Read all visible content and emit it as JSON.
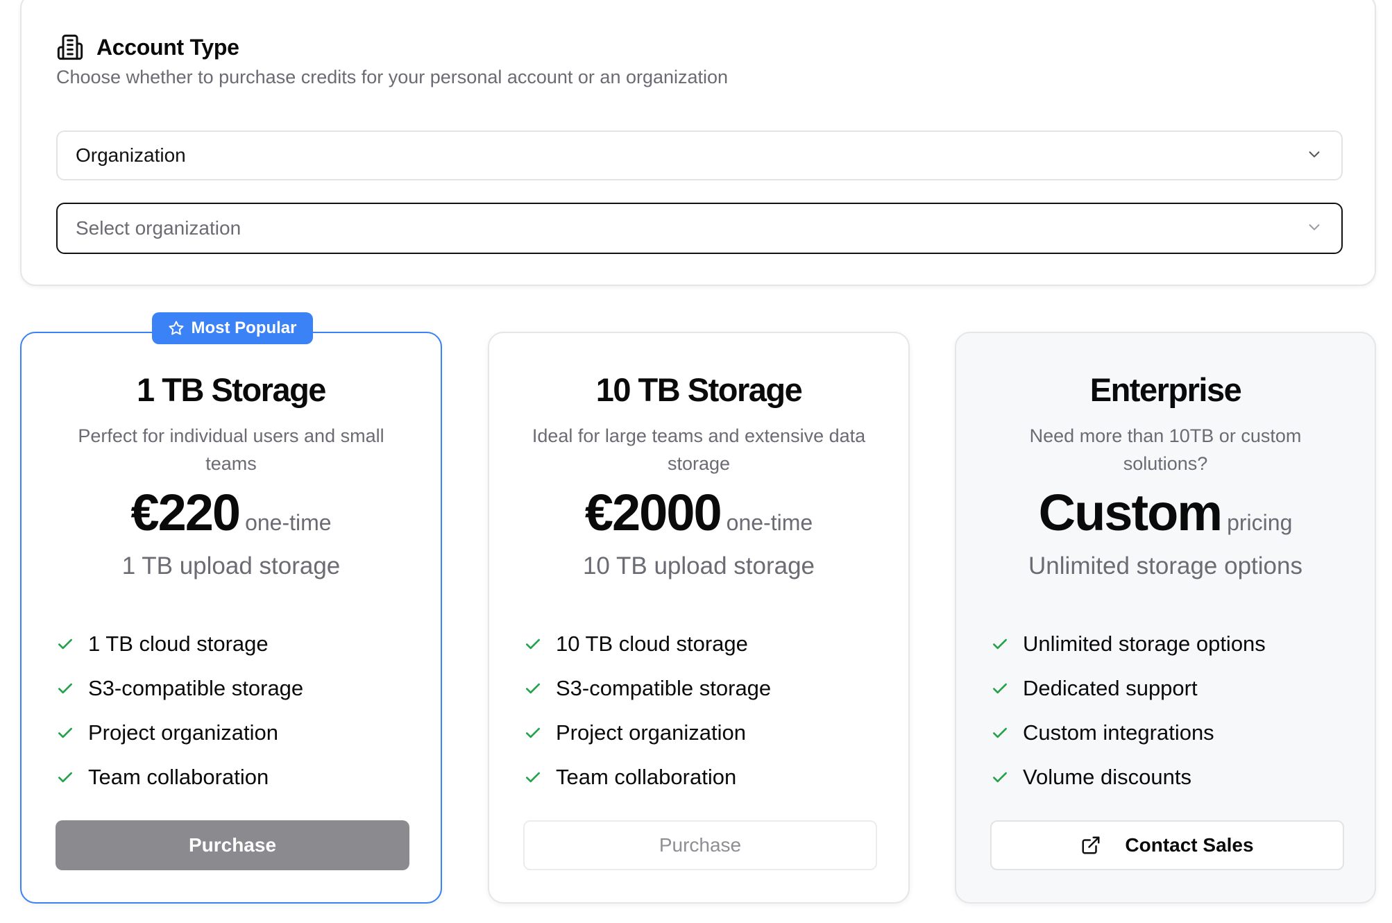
{
  "account": {
    "title": "Account Type",
    "description": "Choose whether to purchase credits for your personal account or an organization",
    "account_select_value": "Organization",
    "org_select_placeholder": "Select organization"
  },
  "plans": [
    {
      "badge": "Most Popular",
      "title": "1 TB Storage",
      "description": "Perfect for individual users and small teams",
      "price": "€220",
      "price_unit": "one-time",
      "subtitle": "1 TB upload storage",
      "features": [
        "1 TB cloud storage",
        "S3-compatible storage",
        "Project organization",
        "Team collaboration"
      ],
      "button": "Purchase"
    },
    {
      "title": "10 TB Storage",
      "description": "Ideal for large teams and extensive data storage",
      "price": "€2000",
      "price_unit": "one-time",
      "subtitle": "10 TB upload storage",
      "features": [
        "10 TB cloud storage",
        "S3-compatible storage",
        "Project organization",
        "Team collaboration"
      ],
      "button": "Purchase"
    },
    {
      "title": "Enterprise",
      "description": "Need more than 10TB or custom solutions?",
      "price": "Custom",
      "price_unit": "pricing",
      "subtitle": "Unlimited storage options",
      "features": [
        "Unlimited storage options",
        "Dedicated support",
        "Custom integrations",
        "Volume discounts"
      ],
      "button": "Contact Sales"
    }
  ],
  "colors": {
    "accent": "#3b82f6",
    "check": "#22a34a",
    "muted_text": "#6b6b73",
    "disabled_button": "#8b8b8f"
  },
  "icons": {
    "account": "building-icon",
    "badge": "star-icon",
    "select": "chevron-down-icon",
    "feature": "check-icon",
    "contact": "external-link-icon"
  }
}
